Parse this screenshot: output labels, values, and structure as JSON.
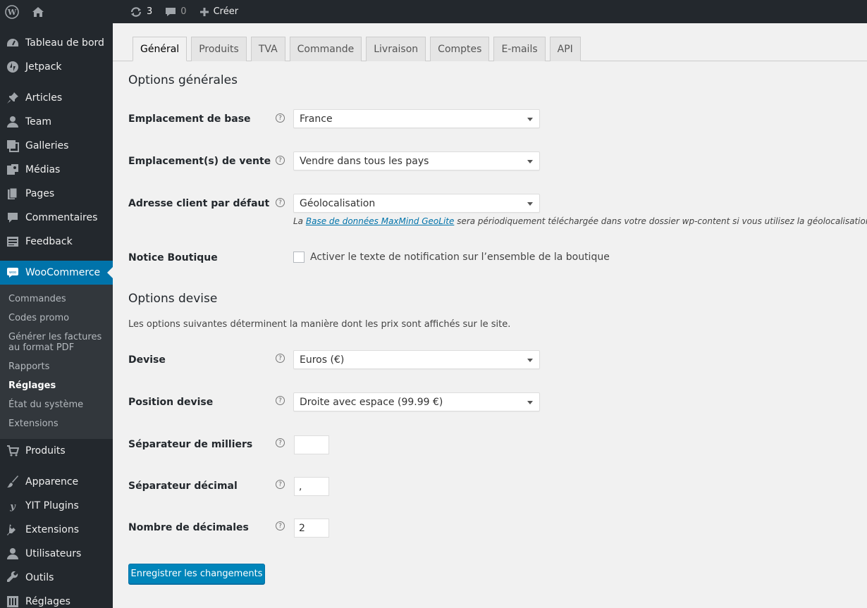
{
  "adminbar": {
    "updates_count": "3",
    "comments_count": "0",
    "new_label": "Créer"
  },
  "sidebar": {
    "items_top": [
      {
        "label": "Tableau de bord",
        "icon": "dashboard-icon"
      },
      {
        "label": "Jetpack",
        "icon": "jetpack-icon"
      }
    ],
    "items_mid": [
      {
        "label": "Articles",
        "icon": "pin-icon"
      },
      {
        "label": "Team",
        "icon": "user-icon"
      },
      {
        "label": "Galleries",
        "icon": "gallery-icon"
      },
      {
        "label": "Médias",
        "icon": "media-icon"
      },
      {
        "label": "Pages",
        "icon": "pages-icon"
      },
      {
        "label": "Commentaires",
        "icon": "comment-icon"
      },
      {
        "label": "Feedback",
        "icon": "feedback-icon"
      }
    ],
    "woocommerce": {
      "label": "WooCommerce",
      "icon": "woo-icon"
    },
    "submenu": [
      "Commandes",
      "Codes promo",
      "Générer les factures au format PDF",
      "Rapports",
      "Réglages",
      "État du système",
      "Extensions"
    ],
    "produits": {
      "label": "Produits",
      "icon": "cart-icon"
    },
    "items_bottom": [
      {
        "label": "Apparence",
        "icon": "brush-icon"
      },
      {
        "label": "YIT Plugins",
        "icon": "yit-icon"
      },
      {
        "label": "Extensions",
        "icon": "plugin-icon"
      },
      {
        "label": "Utilisateurs",
        "icon": "users-icon"
      },
      {
        "label": "Outils",
        "icon": "wrench-icon"
      },
      {
        "label": "Réglages",
        "icon": "settings-icon"
      }
    ]
  },
  "tabs": [
    "Général",
    "Produits",
    "TVA",
    "Commande",
    "Livraison",
    "Comptes",
    "E-mails",
    "API"
  ],
  "general": {
    "section_title": "Options générales",
    "base_location_label": "Emplacement de base",
    "base_location_value": "France",
    "selling_location_label": "Emplacement(s) de vente",
    "selling_location_value": "Vendre dans tous les pays",
    "default_address_label": "Adresse client par défaut",
    "default_address_value": "Géolocalisation",
    "desc_prefix": "La ",
    "desc_link": "Base de données MaxMind GeoLite",
    "desc_suffix": " sera périodiquement téléchargée dans votre dossier wp-content si vous utilisez la géolocalisation.",
    "store_notice_label": "Notice Boutique",
    "store_notice_checkbox": "Activer le texte de notification sur l’ensemble de la boutique"
  },
  "currency": {
    "section_title": "Options devise",
    "intro": "Les options suivantes déterminent la manière dont les prix sont affichés sur le site.",
    "currency_label": "Devise",
    "currency_value": "Euros (€)",
    "position_label": "Position devise",
    "position_value": "Droite avec espace (99.99 €)",
    "thousand_label": "Séparateur de milliers",
    "thousand_value": "",
    "decimal_label": "Séparateur décimal",
    "decimal_value": ",",
    "decimals_label": "Nombre de décimales",
    "decimals_value": "2"
  },
  "save_label": "Enregistrer les changements",
  "help_glyph": "?"
}
